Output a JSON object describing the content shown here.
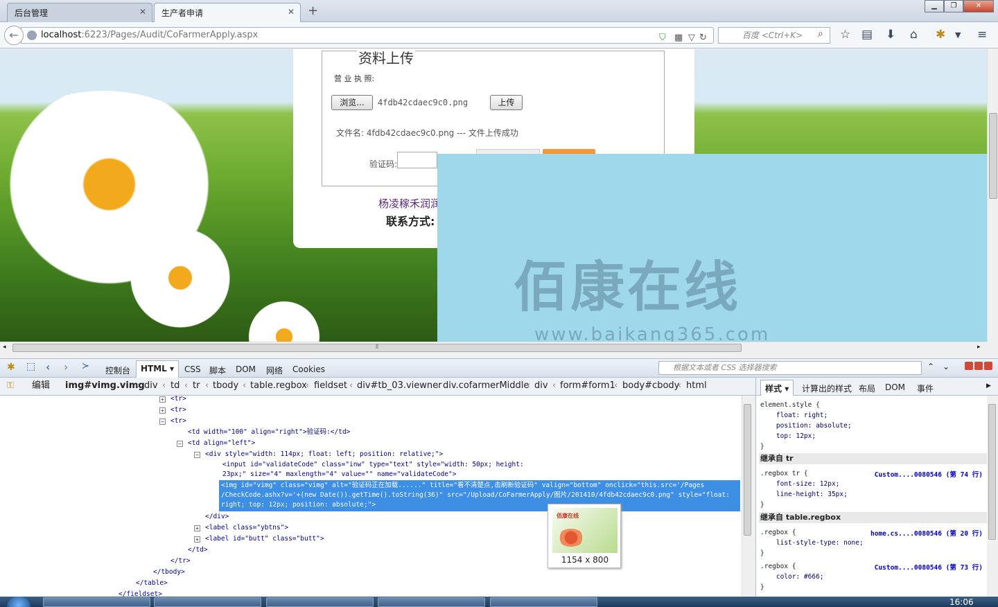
{
  "tabs": [
    {
      "label": "后台管理"
    },
    {
      "label": "生产者申请"
    }
  ],
  "window_buttons": {
    "minimize": "▁",
    "maximize": "❐",
    "close": "✕"
  },
  "url": {
    "host": "localhost",
    "path": ":6223/Pages/Audit/CoFarmerApply.aspx"
  },
  "search": {
    "placeholder": "百度 <Ctrl+K>"
  },
  "page": {
    "legend": "资料上传",
    "license_label": "营 业    执 照:",
    "browse_button": "浏览...",
    "chosen_file": "4fdb42cdaec9c0.png",
    "upload_button": "上传",
    "result_text": "文件名: 4fdb42cdaec9c0.png --- 文件上传成功",
    "captcha_label": "验证码:",
    "company_text": "杨凌稼禾润润",
    "contact_label": "联系方式:",
    "watermark": "佰康在线",
    "watermark_url": "www.baikang365.com"
  },
  "firebug": {
    "tabs": [
      "控制台",
      "HTML",
      "CSS",
      "脚本",
      "DOM",
      "网络",
      "Cookies"
    ],
    "active_tab": "HTML",
    "search_placeholder": "根据文本或者 CSS 选择器搜索",
    "edit_label": "编辑",
    "breadcrumbs": [
      "img#vimg.vimg",
      "div",
      "td",
      "tr",
      "tbody",
      "table.regbox",
      "fieldset",
      "div#tb_03.viewner",
      "div.cofarmerMiddle",
      "div",
      "form#form1",
      "body#cbody",
      "html"
    ],
    "html_lines": [
      "<tr>",
      "<tr>",
      "<tr>",
      "<td width=\"100\" align=\"right\">验证码:</td>",
      "<td align=\"left\">",
      "<div style=\"width: 114px; float: left; position: relative;\">",
      "<input id=\"validateCode\" class=\"inw\" type=\"text\" style=\"width: 50px; height:",
      "23px;\" size=\"4\" maxlength=\"4\" value=\"\" name=\"validateCode\">",
      "</div>",
      "<label class=\"ybtns\">",
      "<label id=\"butt\" class=\"butt\">",
      "</td>",
      "</tr>",
      "</tbody>",
      "</table>",
      "</fieldset>"
    ],
    "selected_lines": [
      "<img id=\"vimg\" class=\"vimg\" alt=\"验证码正在加载......\" title=\"看不清楚点,击刷新验证码\" valign=\"bottom\" onclick=\"this.src='/Pages",
      "/CheckCode.ashx?v='+(new Date()).getTime().toString(36)\" src=\"/Upload/CoFarmerApply/图片/201410/4fdb42cdaec9c0.png\" style=\"float:",
      "right; top: 12px; position: absolute;\">"
    ],
    "tooltip_size": "1154 x 800",
    "side_tabs": [
      "样式",
      "计算出的样式",
      "布局",
      "DOM",
      "事件"
    ],
    "element_style": [
      "element.style {",
      "    float: right;",
      "    position: absolute;",
      "    top: 12px;",
      "}"
    ],
    "inherit_tr": "继承自 tr",
    "rule1": {
      "selector": ".regbox tr {",
      "props": [
        "    font-size: 12px;",
        "    line-height: 35px;"
      ],
      "source": "Custom....0080546 (第 74 行)"
    },
    "inherit_table": "继承自 table.regbox",
    "rule2": {
      "selector": ".regbox {",
      "props": [
        "    list-style-type: none;"
      ],
      "source": "home.cs....0080546 (第 20 行)"
    },
    "rule3": {
      "selector": ".regbox {",
      "props": [
        "    color: #666;"
      ],
      "source": "Custom....0080546 (第 73 行)"
    }
  },
  "taskbar": {
    "clock": "16:06"
  }
}
